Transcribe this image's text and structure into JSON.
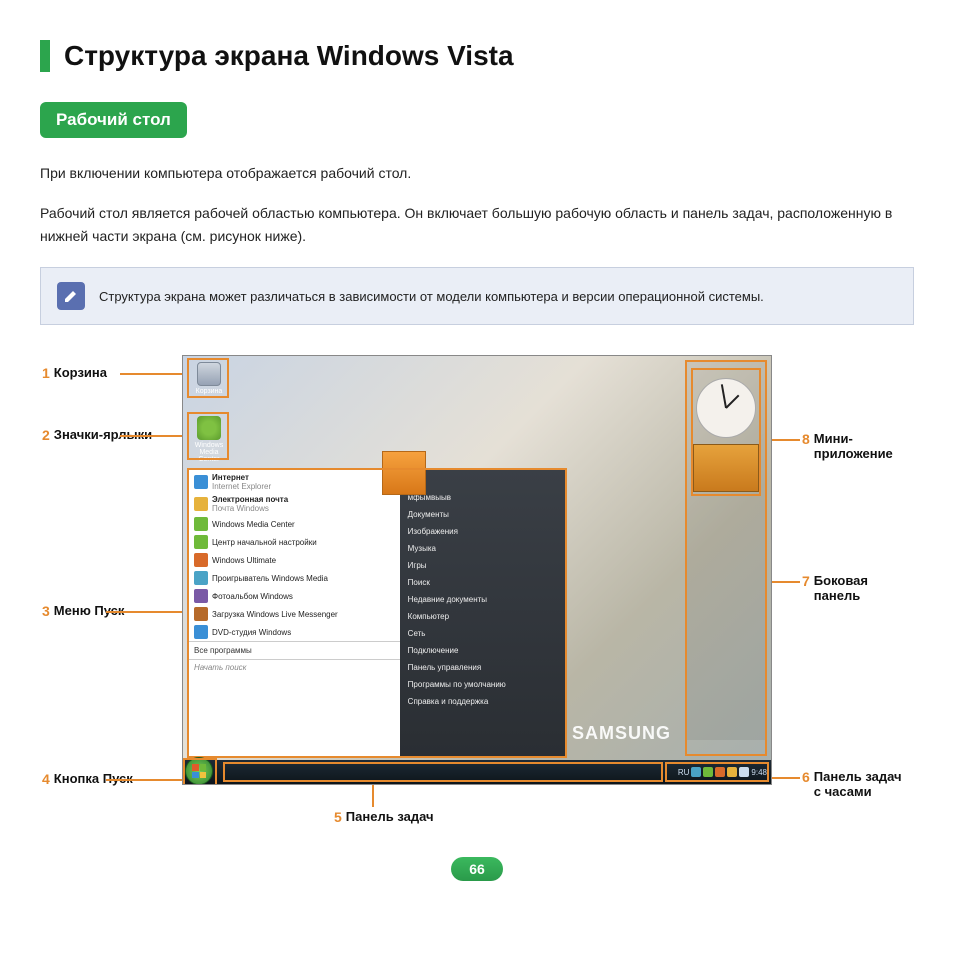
{
  "page": {
    "title": "Структура экрана Windows Vista",
    "section": "Рабочий стол",
    "intro1": "При включении компьютера отображается рабочий стол.",
    "intro2": "Рабочий стол является рабочей областью компьютера. Он включает большую рабочую область и панель задач, расположенную в нижней части экрана (см. рисунок ниже).",
    "note": "Структура экрана может различаться в зависимости от модели компьютера и версии операционной системы.",
    "page_number": "66"
  },
  "callouts": {
    "c1": {
      "num": "1",
      "label": "Корзина"
    },
    "c2": {
      "num": "2",
      "label": "Значки-ярлыки"
    },
    "c3": {
      "num": "3",
      "label": "Меню Пуск"
    },
    "c4": {
      "num": "4",
      "label": "Кнопка Пуск"
    },
    "c5": {
      "num": "5",
      "label": "Панель задач"
    },
    "c6": {
      "num": "6",
      "label": "Панель задач с часами"
    },
    "c7": {
      "num": "7",
      "label": "Боковая панель"
    },
    "c8": {
      "num": "8",
      "label": "Мини-приложение"
    }
  },
  "desktop": {
    "trash_label": "Корзина",
    "mediacenter_label": "Windows Media Center",
    "brand": "SAMSUNG"
  },
  "startmenu": {
    "ie_title": "Интернет",
    "ie_sub": "Internet Explorer",
    "mail_title": "Электронная почта",
    "mail_sub": "Почта Windows",
    "items": [
      "Windows Media Center",
      "Центр начальной настройки",
      "Windows Ultimate",
      "Проигрыватель Windows Media",
      "Фотоальбом Windows",
      "Загрузка Windows Live Messenger",
      "DVD-студия Windows"
    ],
    "all_programs": "Все программы",
    "search_placeholder": "Начать поиск",
    "right": [
      "мфымвыыв",
      "Документы",
      "Изображения",
      "Музыка",
      "Игры",
      "Поиск",
      "Недавние документы",
      "Компьютер",
      "Сеть",
      "Подключение",
      "Панель управления",
      "Программы по умолчанию",
      "Справка и поддержка"
    ]
  },
  "tray": {
    "lang": "RU",
    "time": "9:48"
  },
  "icon_colors": [
    "#3a8fd6",
    "#e6b23c",
    "#6fba3a",
    "#6fba3a",
    "#d86a2a",
    "#4aa3c6",
    "#7a5aa6",
    "#b66a2a"
  ]
}
